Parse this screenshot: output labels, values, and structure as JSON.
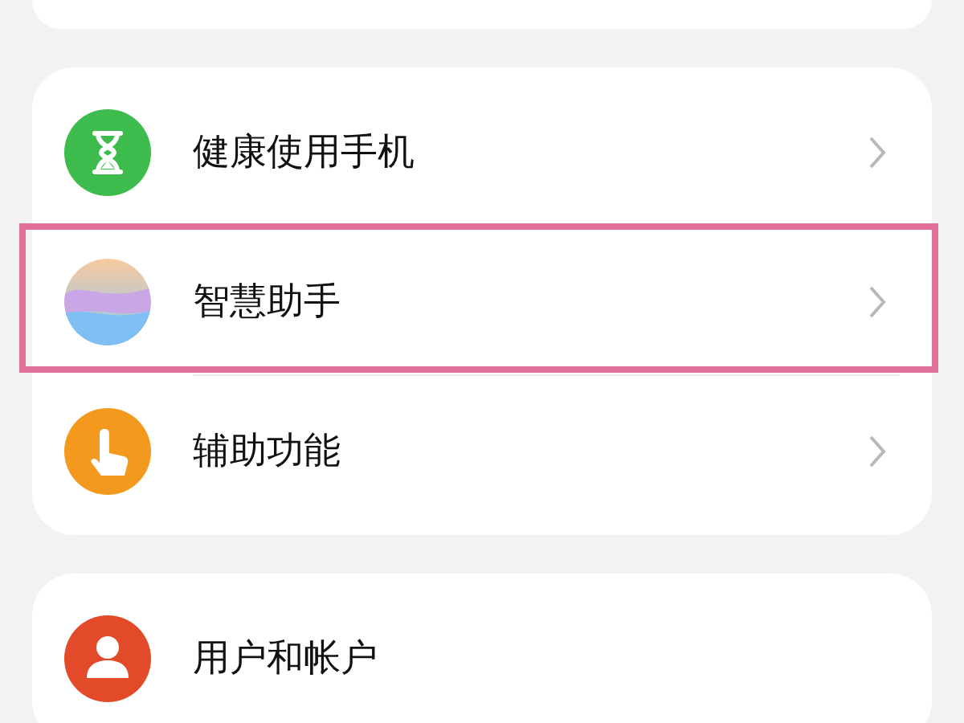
{
  "groups": [
    {
      "items": [
        {
          "label": "健康使用手机",
          "kind": "hourglass",
          "color": "#3dbb4c",
          "chevron": true,
          "highlighted": false
        },
        {
          "label": "智慧助手",
          "kind": "orb",
          "color": "#c9a6e6",
          "chevron": true,
          "highlighted": true
        },
        {
          "label": "辅助功能",
          "kind": "hand",
          "color": "#f39a1e",
          "chevron": true,
          "highlighted": false
        }
      ]
    },
    {
      "items": [
        {
          "label": "用户和帐户",
          "kind": "person",
          "color": "#e24a2a",
          "chevron": false,
          "highlighted": false
        }
      ]
    }
  ]
}
